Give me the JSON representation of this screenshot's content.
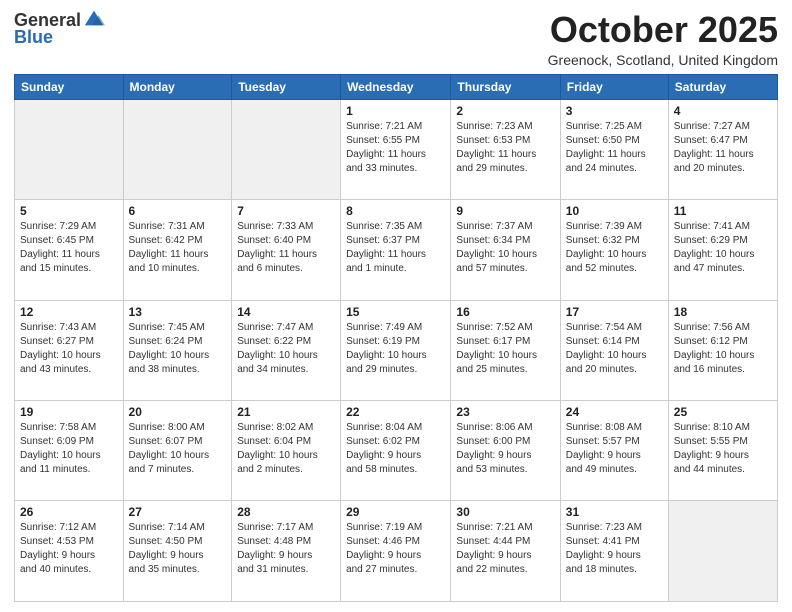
{
  "header": {
    "logo_line1": "General",
    "logo_line2": "Blue",
    "month": "October 2025",
    "location": "Greenock, Scotland, United Kingdom"
  },
  "days_of_week": [
    "Sunday",
    "Monday",
    "Tuesday",
    "Wednesday",
    "Thursday",
    "Friday",
    "Saturday"
  ],
  "weeks": [
    [
      {
        "num": "",
        "info": ""
      },
      {
        "num": "",
        "info": ""
      },
      {
        "num": "",
        "info": ""
      },
      {
        "num": "1",
        "info": "Sunrise: 7:21 AM\nSunset: 6:55 PM\nDaylight: 11 hours\nand 33 minutes."
      },
      {
        "num": "2",
        "info": "Sunrise: 7:23 AM\nSunset: 6:53 PM\nDaylight: 11 hours\nand 29 minutes."
      },
      {
        "num": "3",
        "info": "Sunrise: 7:25 AM\nSunset: 6:50 PM\nDaylight: 11 hours\nand 24 minutes."
      },
      {
        "num": "4",
        "info": "Sunrise: 7:27 AM\nSunset: 6:47 PM\nDaylight: 11 hours\nand 20 minutes."
      }
    ],
    [
      {
        "num": "5",
        "info": "Sunrise: 7:29 AM\nSunset: 6:45 PM\nDaylight: 11 hours\nand 15 minutes."
      },
      {
        "num": "6",
        "info": "Sunrise: 7:31 AM\nSunset: 6:42 PM\nDaylight: 11 hours\nand 10 minutes."
      },
      {
        "num": "7",
        "info": "Sunrise: 7:33 AM\nSunset: 6:40 PM\nDaylight: 11 hours\nand 6 minutes."
      },
      {
        "num": "8",
        "info": "Sunrise: 7:35 AM\nSunset: 6:37 PM\nDaylight: 11 hours\nand 1 minute."
      },
      {
        "num": "9",
        "info": "Sunrise: 7:37 AM\nSunset: 6:34 PM\nDaylight: 10 hours\nand 57 minutes."
      },
      {
        "num": "10",
        "info": "Sunrise: 7:39 AM\nSunset: 6:32 PM\nDaylight: 10 hours\nand 52 minutes."
      },
      {
        "num": "11",
        "info": "Sunrise: 7:41 AM\nSunset: 6:29 PM\nDaylight: 10 hours\nand 47 minutes."
      }
    ],
    [
      {
        "num": "12",
        "info": "Sunrise: 7:43 AM\nSunset: 6:27 PM\nDaylight: 10 hours\nand 43 minutes."
      },
      {
        "num": "13",
        "info": "Sunrise: 7:45 AM\nSunset: 6:24 PM\nDaylight: 10 hours\nand 38 minutes."
      },
      {
        "num": "14",
        "info": "Sunrise: 7:47 AM\nSunset: 6:22 PM\nDaylight: 10 hours\nand 34 minutes."
      },
      {
        "num": "15",
        "info": "Sunrise: 7:49 AM\nSunset: 6:19 PM\nDaylight: 10 hours\nand 29 minutes."
      },
      {
        "num": "16",
        "info": "Sunrise: 7:52 AM\nSunset: 6:17 PM\nDaylight: 10 hours\nand 25 minutes."
      },
      {
        "num": "17",
        "info": "Sunrise: 7:54 AM\nSunset: 6:14 PM\nDaylight: 10 hours\nand 20 minutes."
      },
      {
        "num": "18",
        "info": "Sunrise: 7:56 AM\nSunset: 6:12 PM\nDaylight: 10 hours\nand 16 minutes."
      }
    ],
    [
      {
        "num": "19",
        "info": "Sunrise: 7:58 AM\nSunset: 6:09 PM\nDaylight: 10 hours\nand 11 minutes."
      },
      {
        "num": "20",
        "info": "Sunrise: 8:00 AM\nSunset: 6:07 PM\nDaylight: 10 hours\nand 7 minutes."
      },
      {
        "num": "21",
        "info": "Sunrise: 8:02 AM\nSunset: 6:04 PM\nDaylight: 10 hours\nand 2 minutes."
      },
      {
        "num": "22",
        "info": "Sunrise: 8:04 AM\nSunset: 6:02 PM\nDaylight: 9 hours\nand 58 minutes."
      },
      {
        "num": "23",
        "info": "Sunrise: 8:06 AM\nSunset: 6:00 PM\nDaylight: 9 hours\nand 53 minutes."
      },
      {
        "num": "24",
        "info": "Sunrise: 8:08 AM\nSunset: 5:57 PM\nDaylight: 9 hours\nand 49 minutes."
      },
      {
        "num": "25",
        "info": "Sunrise: 8:10 AM\nSunset: 5:55 PM\nDaylight: 9 hours\nand 44 minutes."
      }
    ],
    [
      {
        "num": "26",
        "info": "Sunrise: 7:12 AM\nSunset: 4:53 PM\nDaylight: 9 hours\nand 40 minutes."
      },
      {
        "num": "27",
        "info": "Sunrise: 7:14 AM\nSunset: 4:50 PM\nDaylight: 9 hours\nand 35 minutes."
      },
      {
        "num": "28",
        "info": "Sunrise: 7:17 AM\nSunset: 4:48 PM\nDaylight: 9 hours\nand 31 minutes."
      },
      {
        "num": "29",
        "info": "Sunrise: 7:19 AM\nSunset: 4:46 PM\nDaylight: 9 hours\nand 27 minutes."
      },
      {
        "num": "30",
        "info": "Sunrise: 7:21 AM\nSunset: 4:44 PM\nDaylight: 9 hours\nand 22 minutes."
      },
      {
        "num": "31",
        "info": "Sunrise: 7:23 AM\nSunset: 4:41 PM\nDaylight: 9 hours\nand 18 minutes."
      },
      {
        "num": "",
        "info": ""
      }
    ]
  ]
}
